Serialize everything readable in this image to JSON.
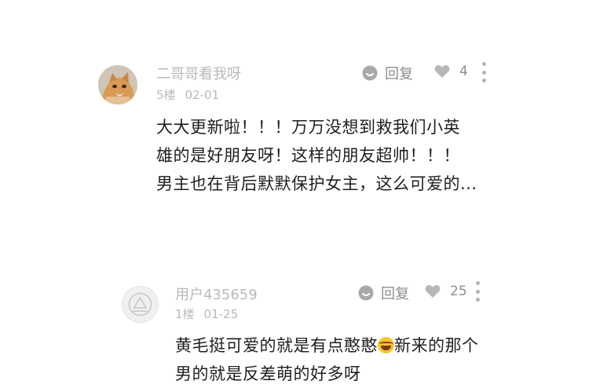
{
  "comments": [
    {
      "username": "二哥哥看我呀",
      "floor": "5楼",
      "date": "02-01",
      "reply_label": "回复",
      "likes": "4",
      "lines": [
        "大大更新啦！！！万万没想到救我们小英",
        "雄的是好朋友呀！这样的朋友超帅！！！",
        "男主也在背后默默保护女主，这么可爱的..."
      ]
    },
    {
      "username": "用户435659",
      "floor": "1楼",
      "date": "01-25",
      "reply_label": "回复",
      "likes": "25",
      "lines": [
        "黄毛挺可爱的就是有点憨憨",
        "新来的那个",
        "男的就是反差萌的好多呀"
      ]
    }
  ],
  "colors": {
    "username": "#b9b9b9",
    "action": "#8e8e8e",
    "text": "#1f1f1f",
    "avatar_cat": "#d99a53"
  },
  "icons": [
    "avatar",
    "reply-bubble-icon",
    "heart-icon",
    "more-vertical-icon",
    "laughing-emoji"
  ]
}
